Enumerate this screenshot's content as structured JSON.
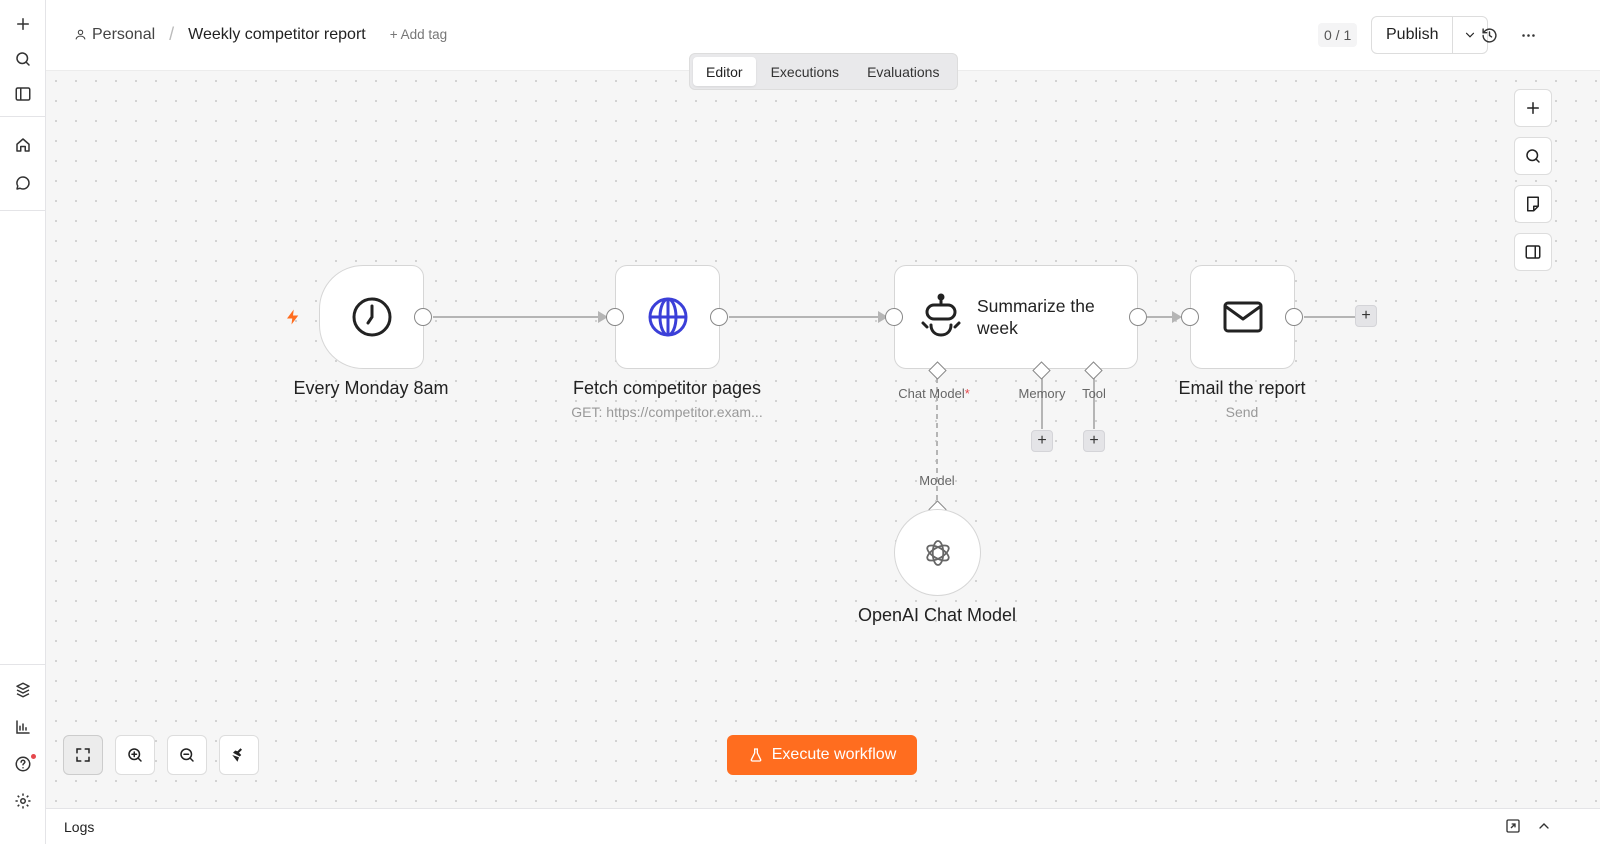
{
  "sidebar": {
    "top_icons": [
      "plus-icon",
      "search-icon",
      "panel-toggle-icon"
    ],
    "nav_icons": [
      "home-icon",
      "chat-icon"
    ],
    "bottom_icons": [
      "templates-icon",
      "insights-icon",
      "help-icon",
      "settings-icon"
    ]
  },
  "header": {
    "project": "Personal",
    "separator": "/",
    "workflow_title": "Weekly competitor report",
    "add_tag": "+ Add tag",
    "counter": "0 / 1",
    "publish": "Publish"
  },
  "tabs": [
    {
      "label": "Editor",
      "active": true
    },
    {
      "label": "Executions",
      "active": false
    },
    {
      "label": "Evaluations",
      "active": false
    }
  ],
  "nodes": {
    "trigger": {
      "label": "Every Monday 8am",
      "icon": "clock-icon"
    },
    "http": {
      "label": "Fetch competitor pages",
      "subtitle": "GET: https://competitor.exam..."
    },
    "agent": {
      "title": "Summarize the week",
      "ports": {
        "chat_model": "Chat Model",
        "required_mark": "*",
        "memory": "Memory",
        "tool": "Tool"
      }
    },
    "email": {
      "label": "Email the report",
      "subtitle": "Send"
    },
    "model": {
      "label": "OpenAI Chat Model",
      "port": "Model"
    }
  },
  "colors": {
    "accent": "#ff6d1f",
    "http_icon": "#3b3fd8",
    "required": "#e5484d"
  },
  "execute_button": "Execute workflow",
  "logs": {
    "label": "Logs"
  }
}
